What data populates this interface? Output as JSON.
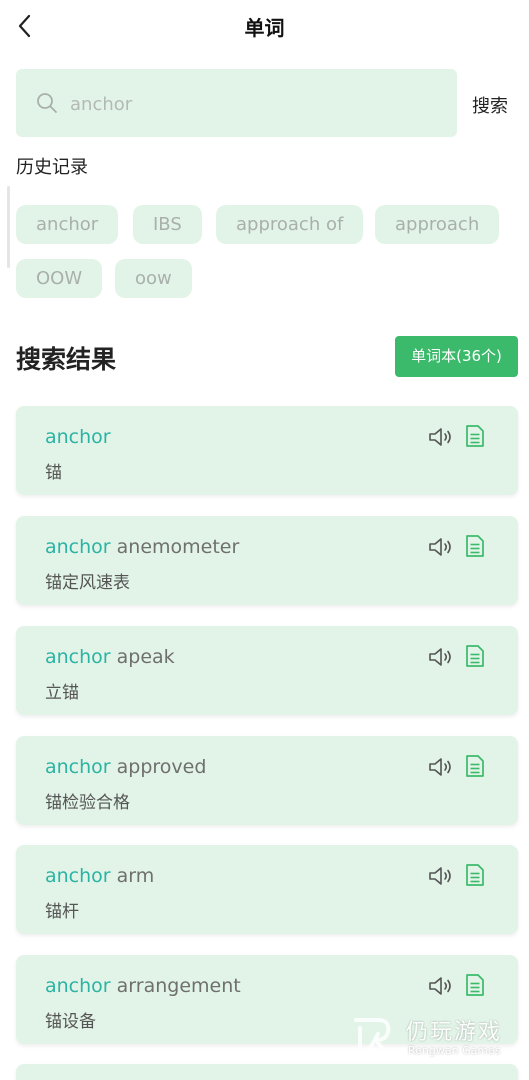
{
  "header": {
    "title": "单词",
    "back_icon": "chevron-left-icon"
  },
  "search": {
    "placeholder": "anchor",
    "value": "",
    "button_label": "搜索",
    "icon": "search-icon"
  },
  "history": {
    "title": "历史记录",
    "chips": [
      "anchor",
      "IBS",
      "approach of",
      "approach",
      "OOW",
      "oow"
    ]
  },
  "results": {
    "title": "搜索结果",
    "wordbook_label": "单词本(36个)",
    "items": [
      {
        "highlight": "anchor",
        "rest": "",
        "meaning": "锚"
      },
      {
        "highlight": "anchor",
        "rest": " anemometer",
        "meaning": "锚定风速表"
      },
      {
        "highlight": "anchor",
        "rest": " apeak",
        "meaning": "立锚"
      },
      {
        "highlight": "anchor",
        "rest": " approved",
        "meaning": "锚检验合格"
      },
      {
        "highlight": "anchor",
        "rest": " arm",
        "meaning": "锚杆"
      },
      {
        "highlight": "anchor",
        "rest": " arrangement",
        "meaning": "锚设备"
      }
    ]
  },
  "watermark": {
    "title": "仍玩游戏",
    "subtitle": "Rengwan Games"
  },
  "colors": {
    "accent": "#3cba6b",
    "highlight": "#2bb3a3",
    "card_bg": "#e2f4e8"
  }
}
